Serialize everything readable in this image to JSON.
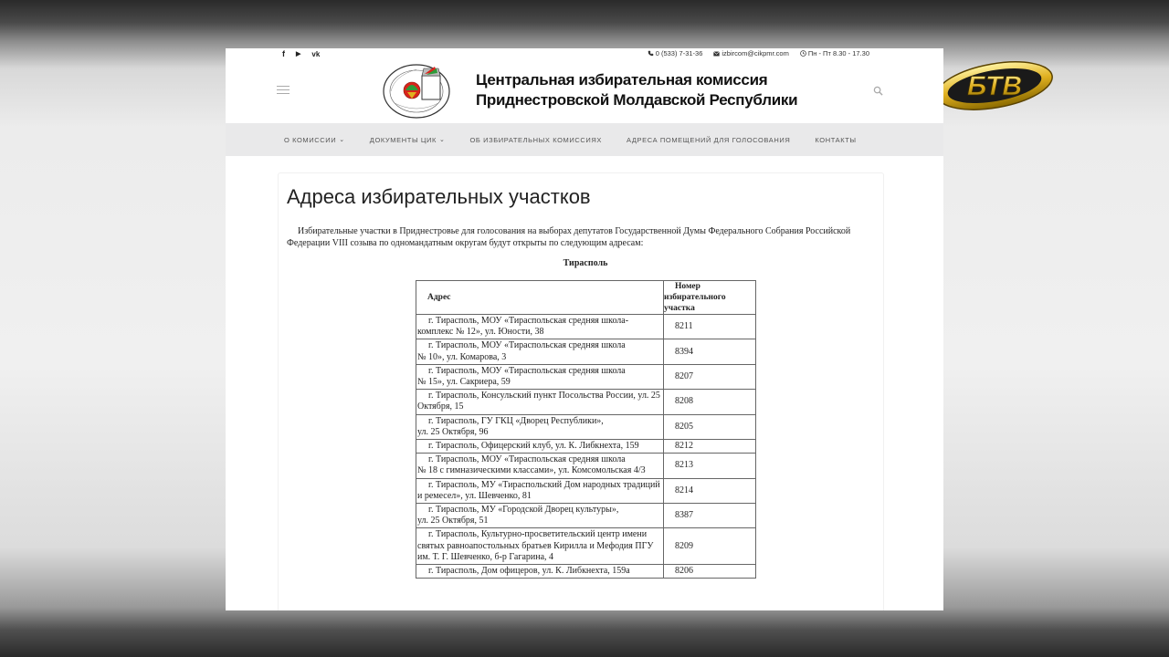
{
  "header": {
    "title_line1": "Центральная избирательная комиссия",
    "title_line2": "Приднестровской Молдавской Республики",
    "phone": "0 (533) 7-31-36",
    "email": "izbircom@cikpmr.com",
    "hours": "Пн - Пт 8.30 - 17.30",
    "social": [
      "f",
      "▶",
      "vk"
    ]
  },
  "nav": {
    "items": [
      {
        "label": "О комиссии",
        "dropdown": "⌄"
      },
      {
        "label": "Документы ЦИК",
        "dropdown": "⌄"
      },
      {
        "label": "Об избирательных комиссиях",
        "dropdown": ""
      },
      {
        "label": "Адреса помещений для голосования",
        "dropdown": ""
      },
      {
        "label": "Контакты",
        "dropdown": ""
      }
    ]
  },
  "main": {
    "heading": "Адреса избирательных участков",
    "intro": "Избирательные участки в Приднестровье для голосования на выборах депутатов Государственной Думы Федерального Собрания Российской Федерации VIII созыва по одномандатным округам будут открыты по следующим адресам:",
    "city": "Тирасполь"
  },
  "table": {
    "headers": {
      "address": "Адрес",
      "number_lines": [
        "Номер",
        "избирательного",
        "участка"
      ]
    },
    "rows": [
      {
        "address": "г. Тирасполь, МОУ «Тираспольская средняя школа-комплекс № 12», ул. Юности, 38",
        "number": "8211"
      },
      {
        "address": "г. Тирасполь, МОУ «Тираспольская средняя школа\n№ 10», ул. Комарова, 3",
        "number": "8394"
      },
      {
        "address": "г. Тирасполь,  МОУ «Тираспольская средняя школа\n№ 15», ул. Сакриера, 59",
        "number": "8207"
      },
      {
        "address": "г. Тирасполь, Консульский пункт Посольства России, ул. 25 Октября, 15",
        "number": "8208"
      },
      {
        "address": "г. Тирасполь, ГУ ГКЦ «Дворец Республики»,\nул. 25 Октября, 96",
        "number": "8205"
      },
      {
        "address": "г. Тирасполь,  Офицерский клуб, ул. К. Либкнехта, 159",
        "number": "8212"
      },
      {
        "address": "г. Тирасполь,  МОУ «Тираспольская средняя школа\n№ 18 с гимназическими классами», ул. Комсомольская 4/3",
        "number": "8213"
      },
      {
        "address": "г. Тирасполь, МУ «Тираспольский Дом народных традиций и ремесел», ул. Шевченко, 81",
        "number": "8214"
      },
      {
        "address": "г. Тирасполь,  МУ «Городской Дворец культуры»,\nул. 25 Октября, 51",
        "number": "8387"
      },
      {
        "address": "г. Тирасполь, Культурно-просветительский центр имени святых равноапостольных братьев Кирилла и Мефодия ПГУ им. Т. Г. Шевченко, б-р Гагарина, 4",
        "number": "8209"
      },
      {
        "address": "г. Тирасполь, Дом офицеров, ул. К. Либкнехта, 159а",
        "number": "8206"
      }
    ]
  },
  "channel_logo": {
    "text": "БТВ",
    "color": "#d4a017"
  }
}
